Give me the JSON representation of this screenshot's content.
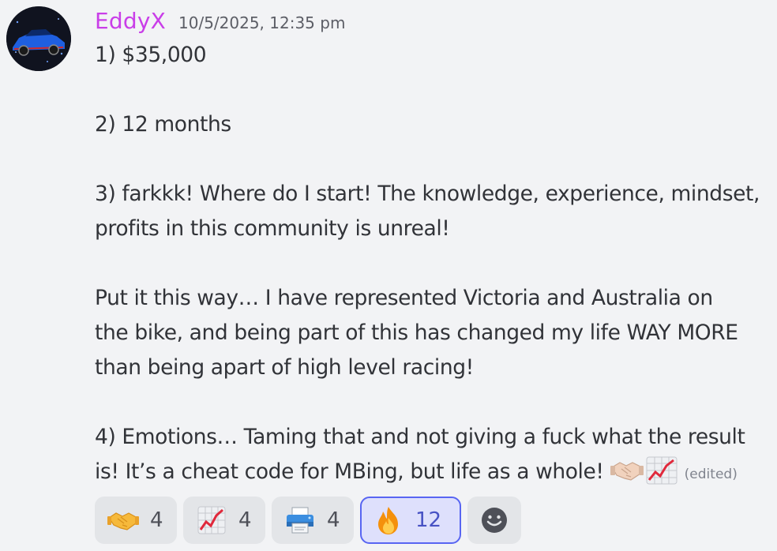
{
  "message": {
    "author": "EddyX",
    "timestamp": "10/5/2025, 12:35 pm",
    "edited_label": "(edited)",
    "lines": {
      "l1": "1) $35,000",
      "l2": "2) 12 months",
      "l3a": "3) farkkk! Where do I start! The knowledge, experience, mindset,",
      "l3b": "profits in this community is unreal!",
      "l4a": "Put it this way… I have represented Victoria and Australia on",
      "l4b": "the bike, and being part of this has changed my life WAY MORE",
      "l4c": "than being apart of high level racing!",
      "l5a": "4) Emotions… Taming that and not giving a fuck what the result",
      "l5b": "is! It’s a cheat code for MBing, but life as a whole!"
    },
    "inline_emojis": [
      "handshake-icon",
      "chart-increasing-icon"
    ]
  },
  "reactions": [
    {
      "emoji": "handshake-icon",
      "count": "4",
      "active": false
    },
    {
      "emoji": "chart-increasing-icon",
      "count": "4",
      "active": false
    },
    {
      "emoji": "printer-icon",
      "count": "4",
      "active": false
    },
    {
      "emoji": "fire-icon",
      "count": "12",
      "active": true
    }
  ],
  "add_reaction": {
    "icon": "smiley-add-icon"
  },
  "colors": {
    "username": "#c93ee8",
    "background": "#f2f3f5",
    "reaction_bg": "#e3e5e8",
    "reaction_active_bg": "#dee0fc",
    "reaction_active_border": "#5865f2"
  }
}
